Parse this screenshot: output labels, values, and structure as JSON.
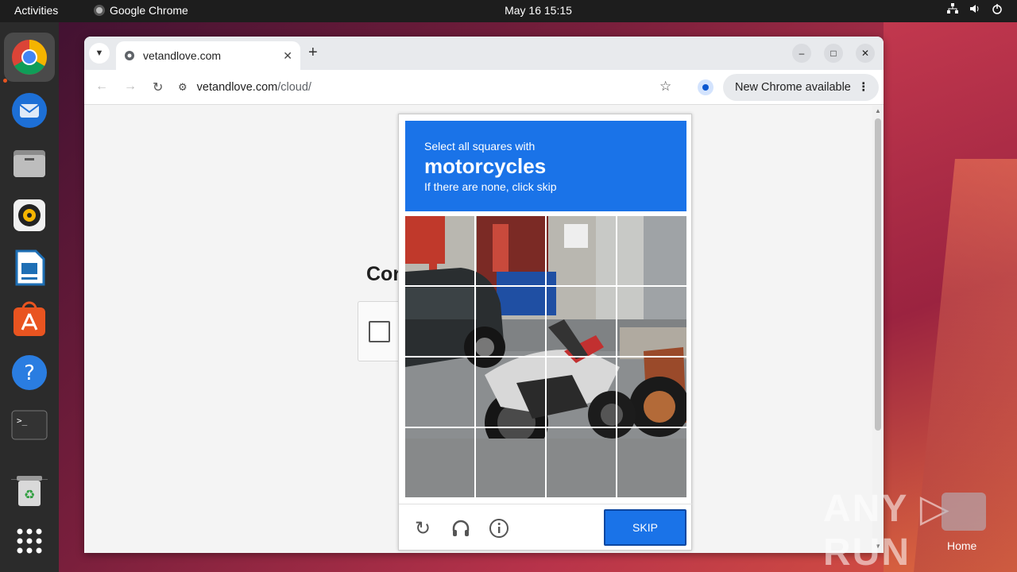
{
  "topbar": {
    "activities": "Activities",
    "app_name": "Google Chrome",
    "clock": "May 16  15:15"
  },
  "dock": {
    "items": [
      "chrome-icon",
      "thunderbird-icon",
      "files-icon",
      "rhythmbox-icon",
      "writer-icon",
      "app-center-icon",
      "help-icon",
      "terminal-icon",
      "trash-icon",
      "app-grid-icon"
    ]
  },
  "browser": {
    "tab_title": "vetandlove.com",
    "url_domain": "vetandlove.com",
    "url_path": "/cloud/",
    "update_label": "New Chrome available"
  },
  "page": {
    "heading_partial": "Cor"
  },
  "captcha": {
    "line1": "Select all squares with",
    "target": "motorcycles",
    "line3": "If there are none, click skip",
    "skip_label": "SKIP"
  },
  "desktop": {
    "watermark": "ANY RUN",
    "home_label": "Home"
  },
  "colors": {
    "captcha_blue": "#1a73e8",
    "dock_bg": "#2b2b2b",
    "topbar_bg": "#1d1d1d"
  }
}
